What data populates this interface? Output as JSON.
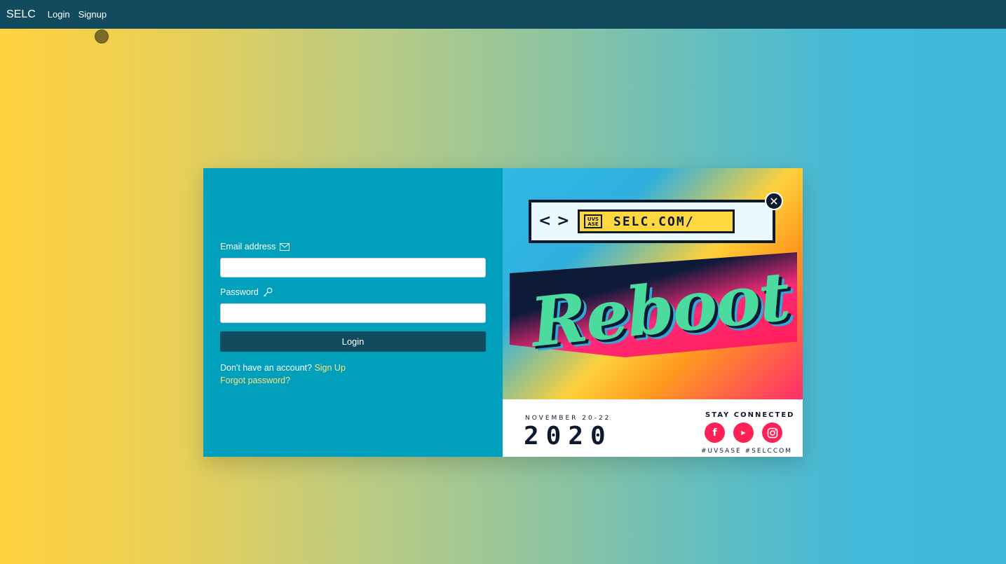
{
  "navbar": {
    "brand": "SELC",
    "links": [
      "Login",
      "Signup"
    ]
  },
  "form": {
    "email_label": "Email address",
    "email_value": "",
    "password_label": "Password",
    "password_value": "",
    "login_button": "Login",
    "no_account_text": "Don't have an account?",
    "signup_link": "Sign Up",
    "forgot_link": "Forgot password?"
  },
  "poster": {
    "url_text": "SELC.COM/",
    "logo_text": "UVS ASE",
    "headline": "Reboot",
    "date_text": "NOVEMBER 20-22",
    "year": "2020",
    "stay_connected": "STAY CONNECTED",
    "hashtags": "#UVSASE #SELCCOM",
    "social_icons": [
      "facebook-icon",
      "youtube-icon",
      "instagram-icon"
    ]
  },
  "colors": {
    "navbar": "#124a5e",
    "left_panel": "#009fbb",
    "button": "#124a5e",
    "link": "#ffe27a"
  }
}
